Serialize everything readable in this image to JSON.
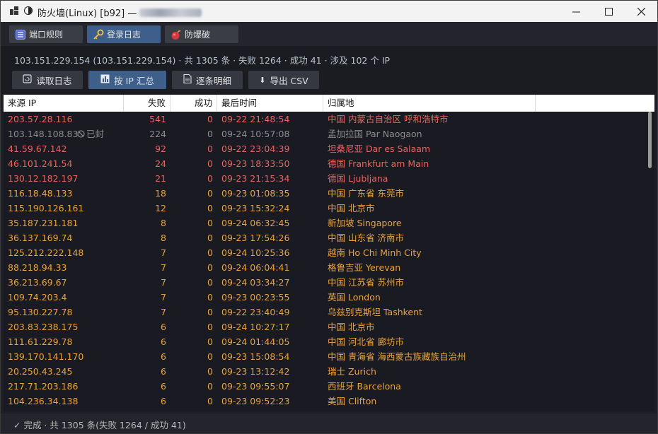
{
  "window": {
    "title": "防火墙(Linux) [b92] —",
    "colors": {
      "accent": "#3e5f8a",
      "red": "#e5645f",
      "orange": "#e8a33d",
      "gray": "#8c8c8c"
    }
  },
  "tabs": [
    {
      "label": "端口规则",
      "icon": "list-icon"
    },
    {
      "label": "登录日志",
      "icon": "key-icon"
    },
    {
      "label": "防爆破",
      "icon": "bomb-icon"
    }
  ],
  "summary": "103.151.229.154 (103.151.229.154) · 共 1305 条 · 失败 1264 · 成功 41 · 涉及 102 个 IP",
  "toolbar": {
    "read_log": "读取日志",
    "by_ip": "按 IP 汇总",
    "detail": "逐条明细",
    "export": "导出 CSV"
  },
  "table": {
    "headers": {
      "ip": "来源 IP",
      "fail": "失败",
      "success": "成功",
      "last_time": "最后时间",
      "location": "归属地"
    },
    "rows": [
      {
        "ip": "203.57.28.116",
        "fail": "541",
        "success": "0",
        "time": "09-22 21:48:54",
        "loc": "中国 内蒙古自治区 呼和浩特市",
        "level": "red"
      },
      {
        "ip": "103.148.108.83",
        "badge": "已封",
        "fail": "224",
        "success": "0",
        "time": "09-24 10:57:08",
        "loc": "孟加拉国 Par Naogaon",
        "level": "gray"
      },
      {
        "ip": "41.59.67.142",
        "fail": "92",
        "success": "0",
        "time": "09-22 23:04:39",
        "loc": "坦桑尼亚 Dar es Salaam",
        "level": "red"
      },
      {
        "ip": "46.101.241.54",
        "fail": "24",
        "success": "0",
        "time": "09-23 18:33:50",
        "loc": "德国 Frankfurt am Main",
        "level": "red"
      },
      {
        "ip": "130.12.182.197",
        "fail": "21",
        "success": "0",
        "time": "09-23 21:15:34",
        "loc": "德国 Ljubljana",
        "level": "red"
      },
      {
        "ip": "116.18.48.133",
        "fail": "18",
        "success": "0",
        "time": "09-23 01:08:35",
        "loc": "中国 广东省 东莞市",
        "level": "orange"
      },
      {
        "ip": "115.190.126.161",
        "fail": "12",
        "success": "0",
        "time": "09-23 15:32:24",
        "loc": "中国 北京市",
        "level": "orange"
      },
      {
        "ip": "35.187.231.181",
        "fail": "8",
        "success": "0",
        "time": "09-24 06:32:45",
        "loc": "新加坡 Singapore",
        "level": "orange"
      },
      {
        "ip": "36.137.169.74",
        "fail": "8",
        "success": "0",
        "time": "09-23 17:54:26",
        "loc": "中国 山东省 济南市",
        "level": "orange"
      },
      {
        "ip": "125.212.222.148",
        "fail": "7",
        "success": "0",
        "time": "09-24 10:25:36",
        "loc": "越南 Ho Chi Minh City",
        "level": "orange"
      },
      {
        "ip": "88.218.94.33",
        "fail": "7",
        "success": "0",
        "time": "09-24 06:04:41",
        "loc": "格鲁吉亚 Yerevan",
        "level": "orange"
      },
      {
        "ip": "36.213.69.67",
        "fail": "7",
        "success": "0",
        "time": "09-24 03:34:27",
        "loc": "中国 江苏省 苏州市",
        "level": "orange"
      },
      {
        "ip": "109.74.203.4",
        "fail": "7",
        "success": "0",
        "time": "09-23 00:23:55",
        "loc": "英国 London",
        "level": "orange"
      },
      {
        "ip": "95.130.227.78",
        "fail": "7",
        "success": "0",
        "time": "09-22 23:40:49",
        "loc": "乌兹别克斯坦 Tashkent",
        "level": "orange"
      },
      {
        "ip": "203.83.238.175",
        "fail": "6",
        "success": "0",
        "time": "09-24 10:27:17",
        "loc": "中国 北京市",
        "level": "orange"
      },
      {
        "ip": "111.61.229.78",
        "fail": "6",
        "success": "0",
        "time": "09-24 01:44:05",
        "loc": "中国 河北省 廊坊市",
        "level": "orange"
      },
      {
        "ip": "139.170.141.170",
        "fail": "6",
        "success": "0",
        "time": "09-23 15:08:54",
        "loc": "中国 青海省 海西蒙古族藏族自治州",
        "level": "orange"
      },
      {
        "ip": "20.250.43.245",
        "fail": "6",
        "success": "0",
        "time": "09-23 13:12:42",
        "loc": "瑞士 Zurich",
        "level": "orange"
      },
      {
        "ip": "217.71.203.186",
        "fail": "6",
        "success": "0",
        "time": "09-23 09:55:07",
        "loc": "西班牙 Barcelona",
        "level": "orange"
      },
      {
        "ip": "104.236.34.138",
        "fail": "6",
        "success": "0",
        "time": "09-23 09:52:23",
        "loc": "美国 Clifton",
        "level": "orange"
      }
    ]
  },
  "status": "✓ 完成 · 共 1305 条(失败 1264 / 成功 41)"
}
